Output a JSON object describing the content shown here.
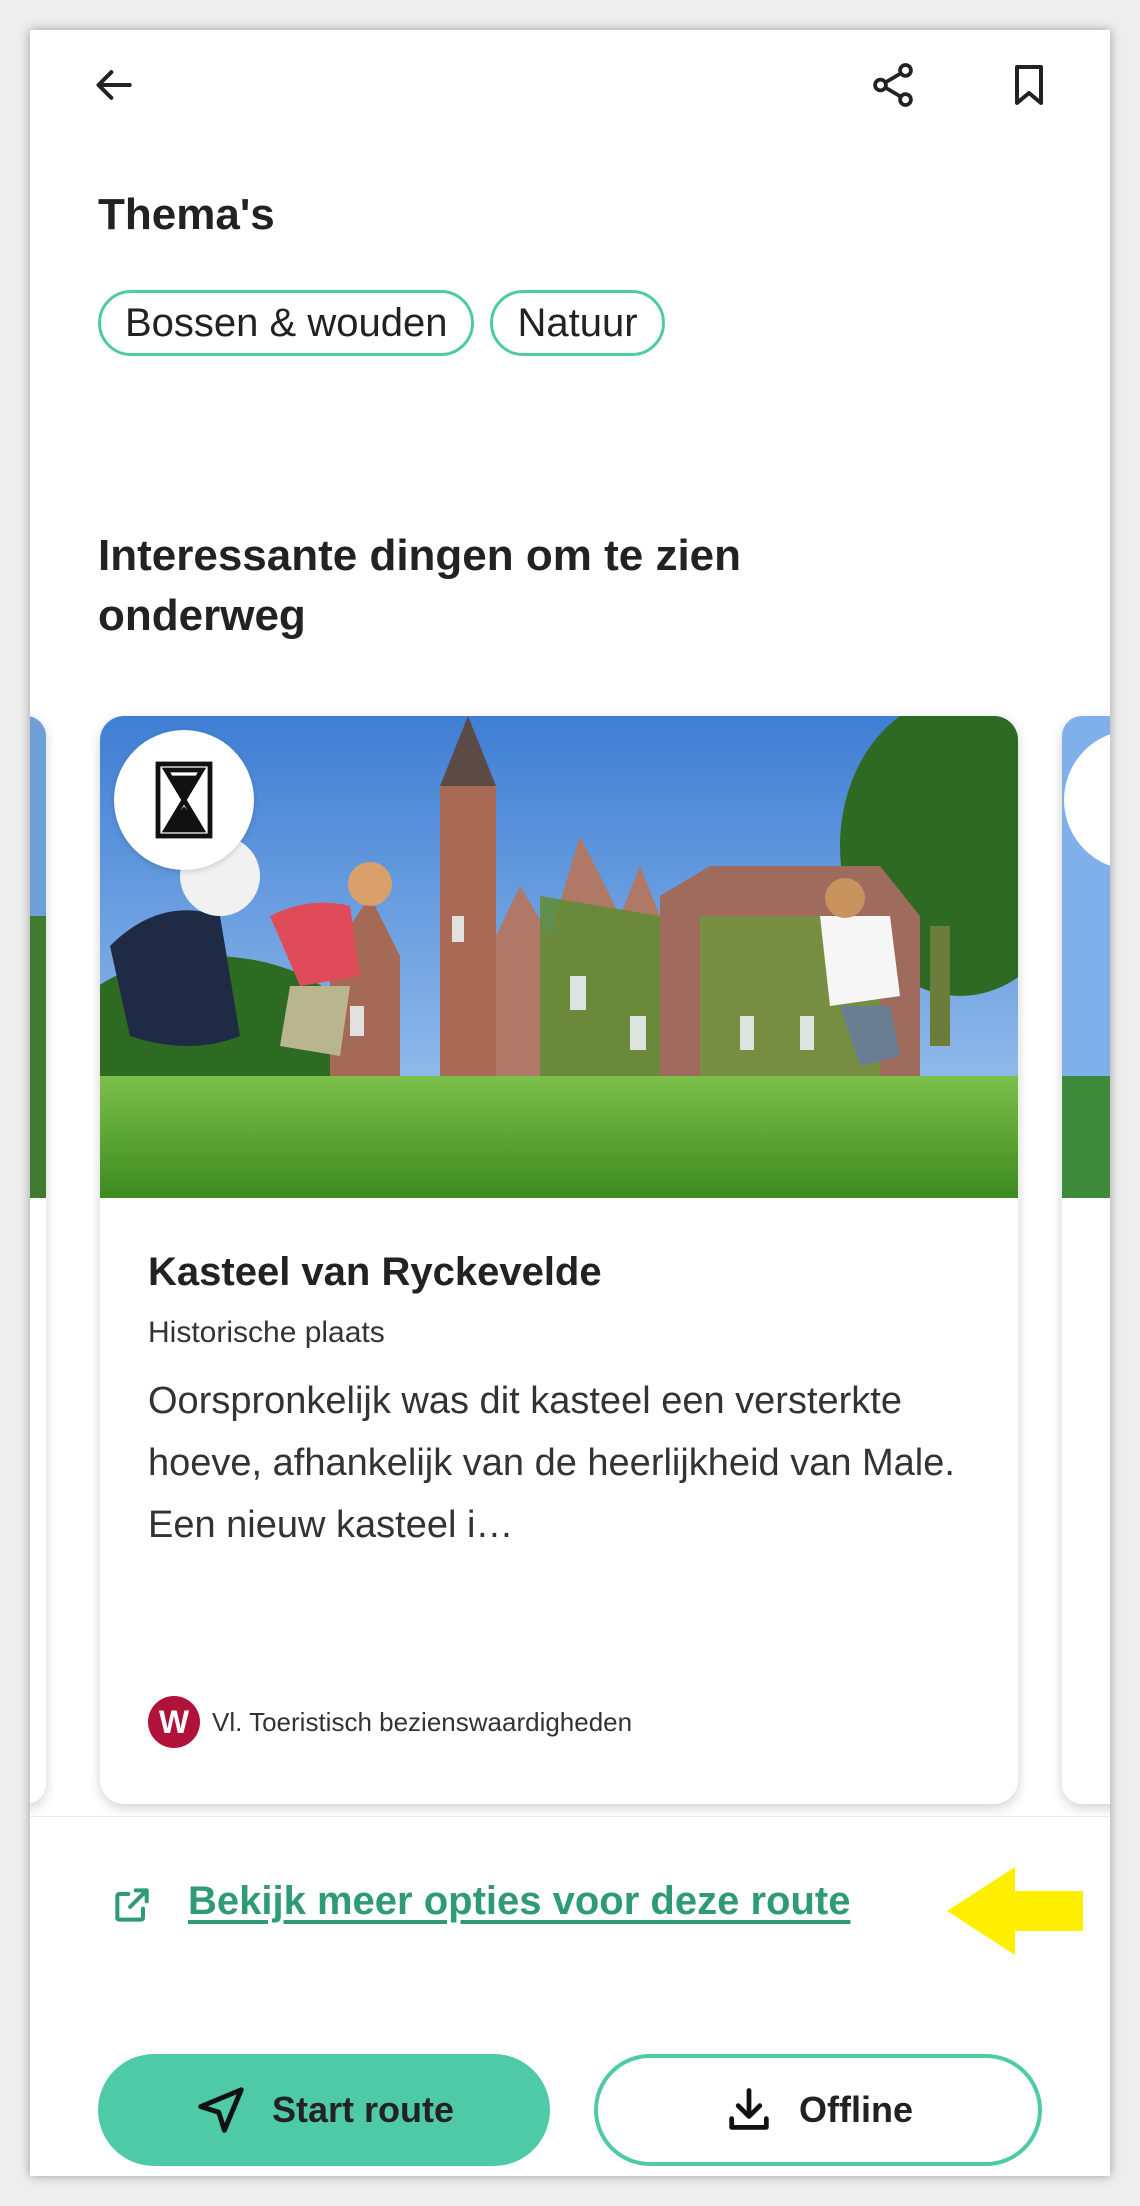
{
  "header": {
    "back_icon": "arrow-left-icon",
    "share_icon": "share-icon",
    "bookmark_icon": "bookmark-icon"
  },
  "themes": {
    "title": "Thema's",
    "chips": [
      "Bossen & wouden",
      "Natuur"
    ]
  },
  "poi_section": {
    "title": "Interessante dingen om te zien onderweg",
    "card": {
      "badge_icon": "hourglass-icon",
      "title": "Kasteel van Ryckevelde",
      "category": "Historische plaats",
      "description": "Oorspronkelijk was dit kasteel een versterkte hoeve, afhankelijk van de heerlijkheid van Male. Een nieuw kasteel i…",
      "source_logo_letter": "W",
      "source": "Vl. Toeristisch bezienswaardigheden"
    }
  },
  "more_options_link": "Bekijk meer opties voor deze route",
  "actions": {
    "start_label": "Start route",
    "offline_label": "Offline"
  },
  "colors": {
    "accent": "#4ecba6",
    "link": "#2f9a76",
    "annotation_arrow": "#ffef00",
    "source_logo": "#b0123a"
  }
}
